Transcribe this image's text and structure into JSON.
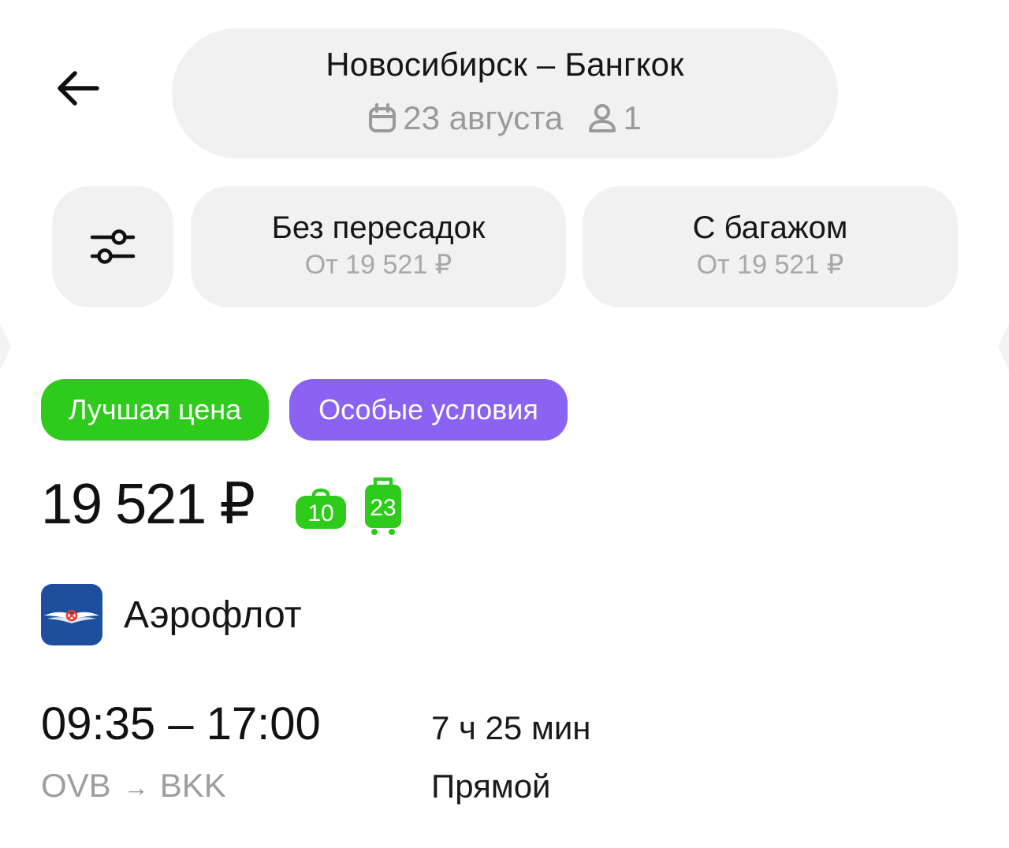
{
  "header": {
    "back_icon": "arrow-left-icon",
    "route_title": "Новосибирск – Бангкок",
    "date": "23 августа",
    "date_icon": "calendar-icon",
    "passengers": "1",
    "passengers_icon": "person-icon"
  },
  "filters": {
    "settings_icon": "sliders-icon",
    "chips": [
      {
        "title": "Без пересадок",
        "subtitle": "От 19 521 ₽"
      },
      {
        "title": "С багажом",
        "subtitle": "От 19 521 ₽"
      }
    ]
  },
  "offer": {
    "badges": [
      {
        "label": "Лучшая цена",
        "color": "#2fcb1c"
      },
      {
        "label": "Особые условия",
        "color": "#8a63f3"
      }
    ],
    "price": "19 521 ₽",
    "hand_luggage_kg": "10",
    "checked_baggage_kg": "23",
    "baggage_color": "#2fcb1c",
    "airline": {
      "name": "Аэрофлот",
      "logo_icon": "aeroflot-logo-icon",
      "logo_color": "#1d4f9e"
    },
    "departure_time": "09:35",
    "arrival_time": "17:00",
    "times": "09:35 – 17:00",
    "origin": "OVB",
    "destination": "BKK",
    "route_arrow": "→",
    "duration": "7 ч 25 мин",
    "stops": "Прямой"
  }
}
